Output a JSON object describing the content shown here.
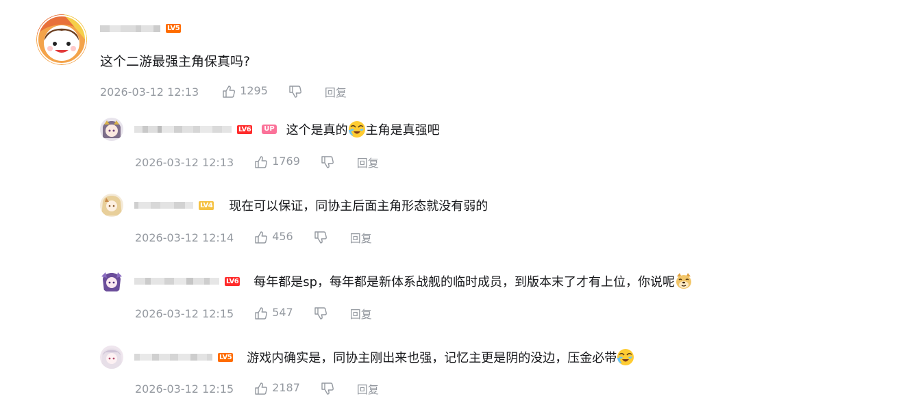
{
  "main_comment": {
    "level": "LV5",
    "text": "这个二游最强主角保真吗?",
    "time": "2026-03-12 12:13",
    "likes": "1295",
    "reply_label": "回复"
  },
  "replies": [
    {
      "level": "LV6",
      "up_badge": "UP",
      "text_before": "这个是真的",
      "emoji": "laughing-cry-emoji",
      "text_after": "主角是真强吧",
      "time": "2026-03-12 12:13",
      "likes": "1769",
      "reply_label": "回复"
    },
    {
      "level": "LV4",
      "text": "现在可以保证，同协主后面主角形态就没有弱的",
      "time": "2026-03-12 12:14",
      "likes": "456",
      "reply_label": "回复"
    },
    {
      "level": "LV6",
      "text": "每年都是sp，每年都是新体系战舰的临时成员，到版本末了才有上位，你说呢",
      "emoji": "doge-emoji",
      "time": "2026-03-12 12:15",
      "likes": "547",
      "reply_label": "回复"
    },
    {
      "level": "LV5",
      "text": "游戏内确实是，同协主刚出来也强，记忆主更是阴的没边，压金必带",
      "emoji": "laughing-cry-emoji",
      "time": "2026-03-12 12:15",
      "likes": "2187",
      "reply_label": "回复"
    }
  ],
  "colors": {
    "text": "#18191c",
    "meta": "#9499a0",
    "lv4": "#f5c243",
    "lv5": "#ff6c00",
    "lv6": "#ff2b2b",
    "up": "#fb7299"
  }
}
